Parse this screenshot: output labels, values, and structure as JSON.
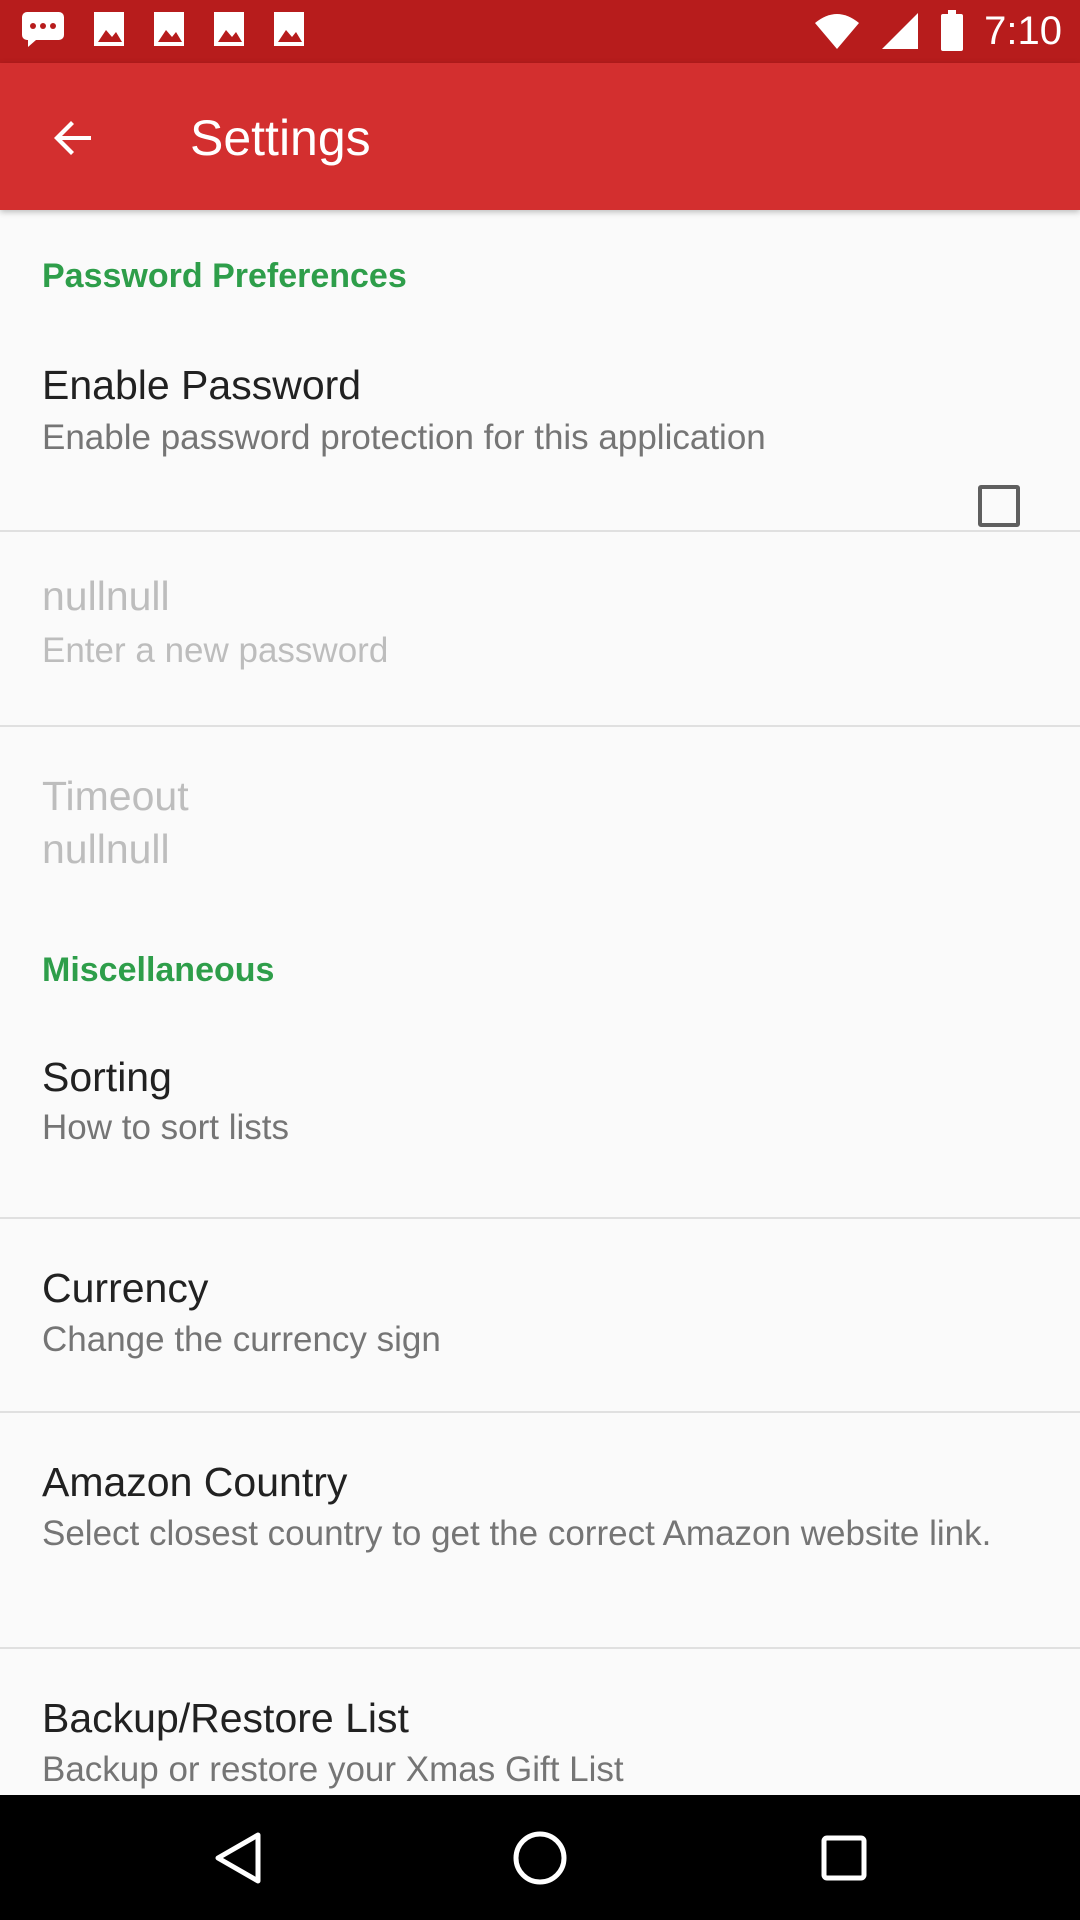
{
  "status_bar": {
    "time": "7:10",
    "left_icons": [
      "message-icon",
      "photo-icon",
      "photo-icon",
      "photo-icon",
      "photo-icon"
    ],
    "right_icons": [
      "wifi-icon",
      "signal-icon",
      "battery-icon"
    ]
  },
  "app_bar": {
    "back_icon": "arrow-back-icon",
    "title": "Settings"
  },
  "sections": {
    "password": {
      "header": "Password Preferences",
      "enable_password": {
        "title": "Enable Password",
        "summary": "Enable password protection for this application",
        "checked": false
      },
      "new_password": {
        "title": "nullnull",
        "summary": "Enter a new password"
      },
      "timeout": {
        "title": "Timeout",
        "summary": "nullnull"
      }
    },
    "misc": {
      "header": "Miscellaneous",
      "sorting": {
        "title": "Sorting",
        "summary": "How to sort lists"
      },
      "currency": {
        "title": "Currency",
        "summary": "Change the currency sign"
      },
      "amazon": {
        "title": "Amazon Country",
        "summary": "Select closest country to get the correct Amazon website link."
      },
      "backup": {
        "title": "Backup/Restore List",
        "summary": "Backup or restore your Xmas Gift List"
      }
    }
  },
  "nav_bar": {
    "icons": [
      "back-triangle-icon",
      "home-circle-icon",
      "recents-square-icon"
    ]
  },
  "colors": {
    "status_bar": "#b71c1c",
    "app_bar": "#d32f2f",
    "category_text": "#2e9e4a"
  }
}
